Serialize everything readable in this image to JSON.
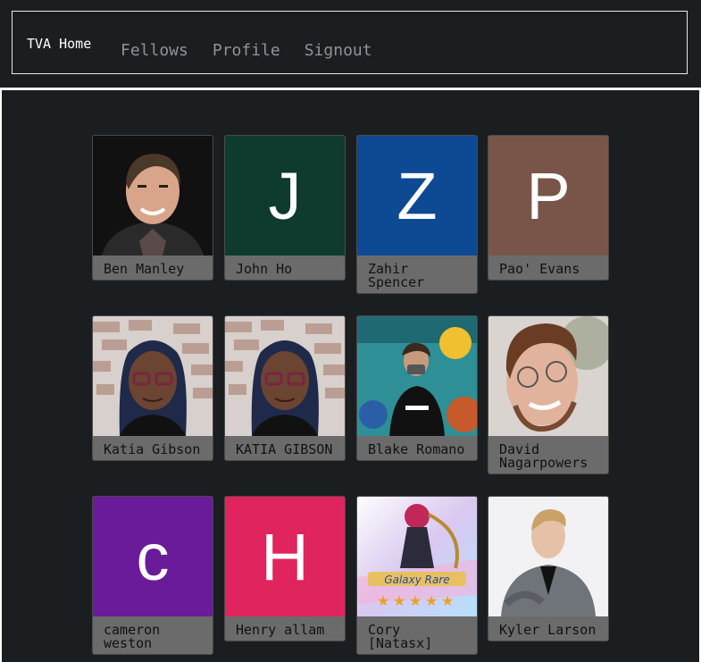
{
  "nav": {
    "brand": "TVA Home",
    "links": [
      "Fellows",
      "Profile",
      "Signout"
    ]
  },
  "fellows": [
    {
      "name": "Ben Manley",
      "type": "photo",
      "photo": "ben"
    },
    {
      "name": "John Ho",
      "type": "letter",
      "letter": "J",
      "color": "#0e3b2e"
    },
    {
      "name": "Zahir Spencer",
      "type": "letter",
      "letter": "Z",
      "color": "#0e4a94"
    },
    {
      "name": "Pao' Evans",
      "type": "letter",
      "letter": "P",
      "color": "#795549"
    },
    {
      "name": "Katia Gibson",
      "type": "photo",
      "photo": "katia"
    },
    {
      "name": "KATIA GIBSON",
      "type": "photo",
      "photo": "katia"
    },
    {
      "name": "Blake Romano",
      "type": "photo",
      "photo": "blake"
    },
    {
      "name": "David Nagarpowers",
      "type": "photo",
      "photo": "david"
    },
    {
      "name": "cameron weston",
      "type": "letter",
      "letter": "c",
      "color": "#6a1b9a"
    },
    {
      "name": "Henry allam",
      "type": "letter",
      "letter": "H",
      "color": "#e0245e"
    },
    {
      "name": "Cory [Natasx]",
      "type": "photo",
      "photo": "cory"
    },
    {
      "name": "Kyler Larson",
      "type": "photo",
      "photo": "kyler"
    }
  ]
}
